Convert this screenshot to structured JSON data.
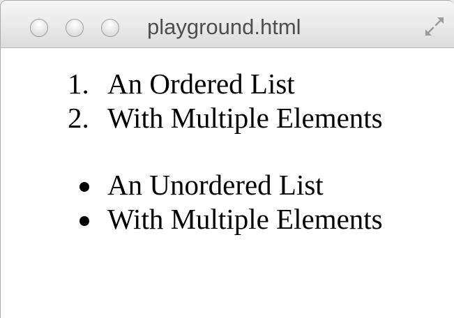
{
  "window": {
    "title": "playground.html"
  },
  "ordered_list": {
    "items": [
      {
        "marker": "1.",
        "text": "An Ordered List"
      },
      {
        "marker": "2.",
        "text": "With Multiple Elements"
      }
    ]
  },
  "unordered_list": {
    "items": [
      {
        "text": "An Unordered List"
      },
      {
        "text": "With Multiple Elements"
      }
    ]
  },
  "icons": {
    "close": "close-icon",
    "minimize": "minimize-icon",
    "zoom": "zoom-icon",
    "fullscreen": "fullscreen-icon"
  }
}
